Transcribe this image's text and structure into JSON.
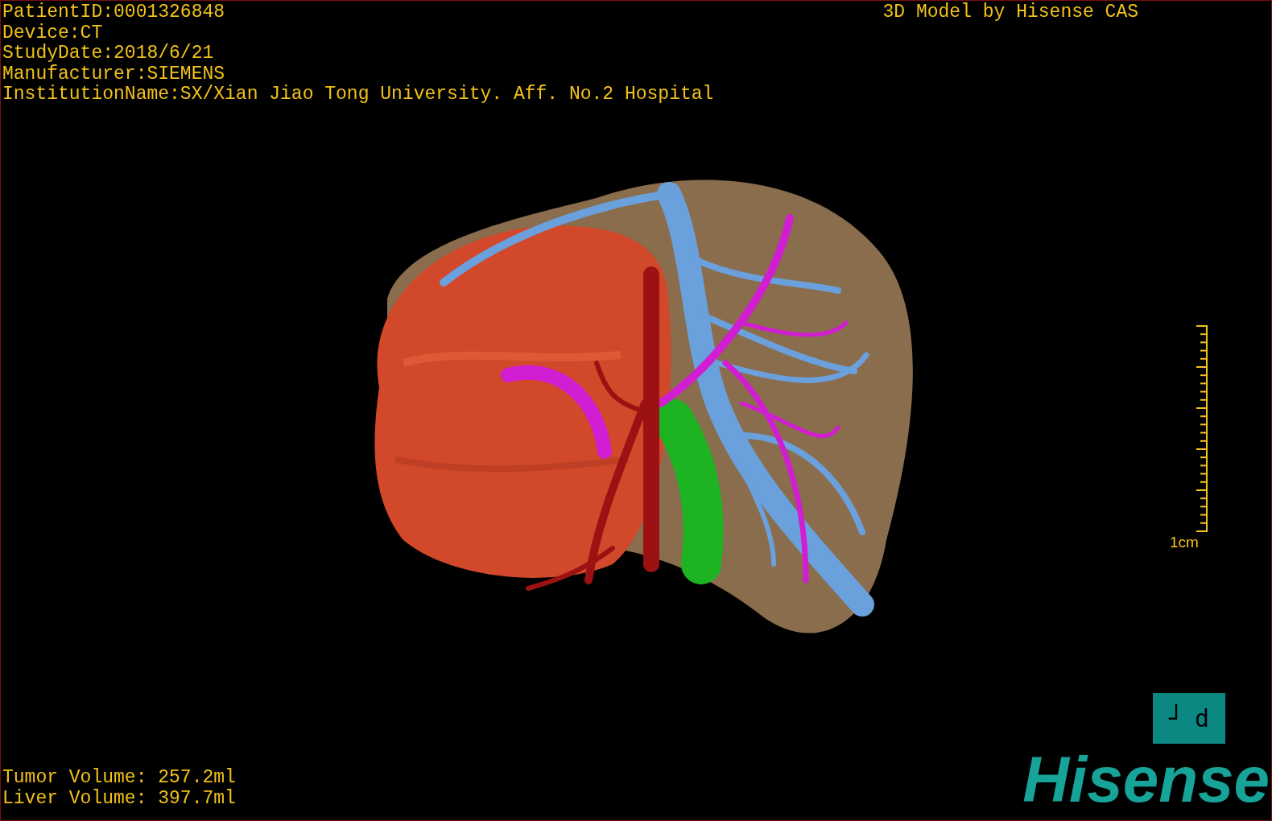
{
  "info_lines": [
    "PatientID:0001326848",
    "Device:CT",
    "StudyDate:2018/6/21",
    "Manufacturer:SIEMENS",
    "InstitutionName:SX/Xian Jiao Tong University. Aff. No.2 Hospital"
  ],
  "credit": "3D Model by Hisense CAS",
  "scale": {
    "label": "1cm"
  },
  "orientation": {
    "labels": [
      "┘",
      "d"
    ]
  },
  "volumes": [
    "Tumor Volume: 257.2ml",
    "Liver Volume: 397.7ml"
  ],
  "logo": "Hisense"
}
